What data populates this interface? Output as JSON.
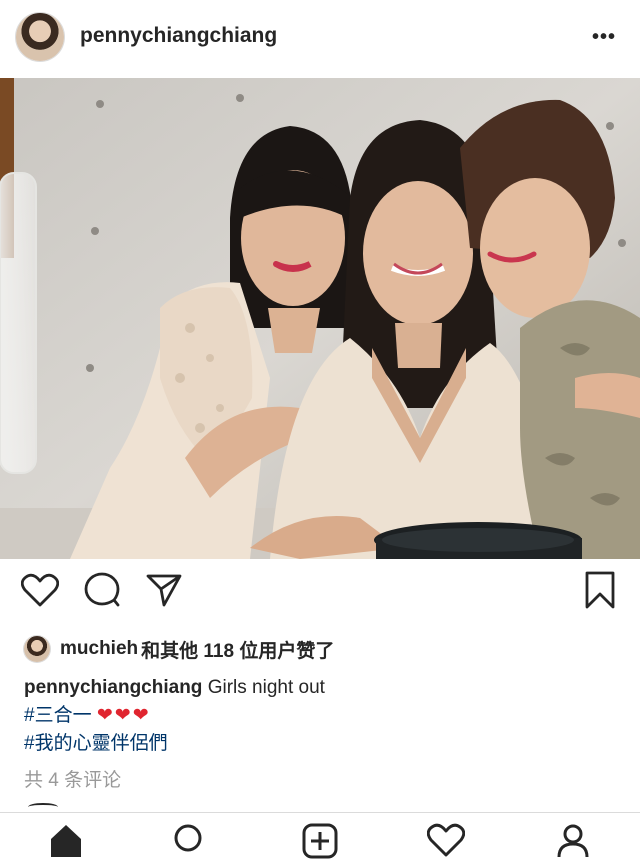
{
  "post": {
    "username": "pennychiangchiang",
    "more_label": "•••"
  },
  "likes": {
    "user": "muchieh",
    "text": "和其他 118 位用户赞了"
  },
  "caption": {
    "user": "pennychiangchiang",
    "text": "Girls night out",
    "hashtag1": "#三合一",
    "hearts": "❤❤❤",
    "hashtag2": "#我的心靈伴侶們"
  },
  "comments_link": "共 4 条评论",
  "icons": {
    "like": "heart-icon",
    "comment": "comment-icon",
    "share": "send-icon",
    "save": "bookmark-icon",
    "tabs": [
      "home-icon",
      "search-icon",
      "new-post-icon",
      "activity-icon",
      "profile-icon"
    ]
  },
  "colors": {
    "hashtag": "#003569",
    "heart": "#e0252f",
    "muted": "#999999",
    "text": "#262626"
  }
}
